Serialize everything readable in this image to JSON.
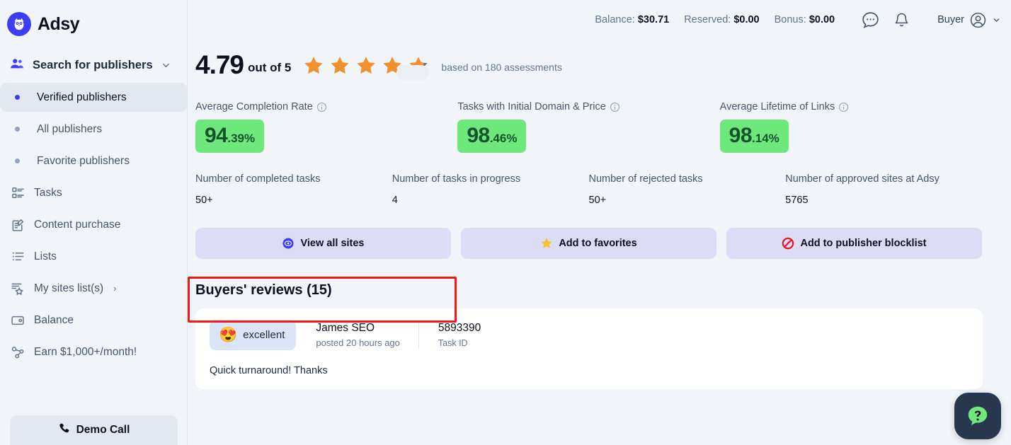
{
  "brand": {
    "name": "Adsy",
    "logo_icon": "owl-logo-icon"
  },
  "sidebar": {
    "search": {
      "label": "Search for publishers",
      "icon": "users-icon",
      "chevron": "chevron-down-icon"
    },
    "items": [
      {
        "label": "Verified publishers",
        "icon": "dot-icon",
        "active": true
      },
      {
        "label": "All publishers",
        "icon": "dot-icon",
        "active": false
      },
      {
        "label": "Favorite publishers",
        "icon": "dot-icon",
        "active": false
      },
      {
        "label": "Tasks",
        "icon": "tasks-icon",
        "active": false
      },
      {
        "label": "Content purchase",
        "icon": "content-purchase-icon",
        "active": false
      },
      {
        "label": "Lists",
        "icon": "lists-icon",
        "active": false
      },
      {
        "label": "My sites list(s)",
        "icon": "my-sites-star-icon",
        "active": false,
        "arrow": "›"
      },
      {
        "label": "Balance",
        "icon": "wallet-icon",
        "active": false
      },
      {
        "label": "Earn $1,000+/month!",
        "icon": "share-nodes-icon",
        "active": false
      }
    ],
    "demo_call": {
      "label": "Demo Call",
      "icon": "phone-icon"
    }
  },
  "header": {
    "balance_label": "Balance:",
    "balance_value": "$30.71",
    "reserved_label": "Reserved:",
    "reserved_value": "$0.00",
    "bonus_label": "Bonus:",
    "bonus_value": "$0.00",
    "chat_icon": "chat-dots-icon",
    "bell_icon": "bell-icon",
    "user_role": "Buyer",
    "user_icon": "user-avatar-icon",
    "user_chevron": "chevron-down-icon"
  },
  "rating": {
    "value": "4.79",
    "out_of": "out of 5",
    "stars_filled": 4.79,
    "stars_total": 5,
    "note": "based on 180 assessments",
    "star_color": "#f0912e",
    "star_empty_color": "#64748b"
  },
  "metrics": [
    {
      "label": "Average Completion Rate",
      "info_icon": "info-icon",
      "int": "94",
      "dec": ".39%"
    },
    {
      "label": "Tasks with Initial Domain & Price",
      "info_icon": "info-icon",
      "int": "98",
      "dec": ".46%"
    },
    {
      "label": "Average Lifetime of Links",
      "info_icon": "info-icon",
      "int": "98",
      "dec": ".14%"
    }
  ],
  "stats": [
    {
      "label": "Number of completed tasks",
      "value": "50+"
    },
    {
      "label": "Number of tasks in progress",
      "value": "4"
    },
    {
      "label": "Number of rejected tasks",
      "value": "50+"
    },
    {
      "label": "Number of approved sites at Adsy",
      "value": "5765"
    }
  ],
  "actions": {
    "view_all_sites": {
      "label": "View all sites",
      "icon": "eye-circle-icon",
      "highlighted": true
    },
    "add_to_favorites": {
      "label": "Add to favorites",
      "icon": "star-icon"
    },
    "add_to_blocklist": {
      "label": "Add to publisher blocklist",
      "icon": "prohibited-icon"
    }
  },
  "reviews": {
    "title": "Buyers' reviews (15)",
    "items": [
      {
        "sentiment": "excellent",
        "sentiment_emoji": "😍",
        "reviewer": "James SEO",
        "posted": "posted 20 hours ago",
        "task_id": "5893390",
        "task_id_label": "Task ID",
        "text": "Quick turnaround! Thanks"
      }
    ]
  },
  "help": {
    "icon": "question-chat-icon"
  },
  "colors": {
    "accent": "#3d3df5",
    "badge_green": "#6ee87a",
    "badge_text": "#14532d",
    "highlight_red": "#ef1b1b",
    "page_bg": "#f1f5f9",
    "card_bg": "#ffffff"
  }
}
